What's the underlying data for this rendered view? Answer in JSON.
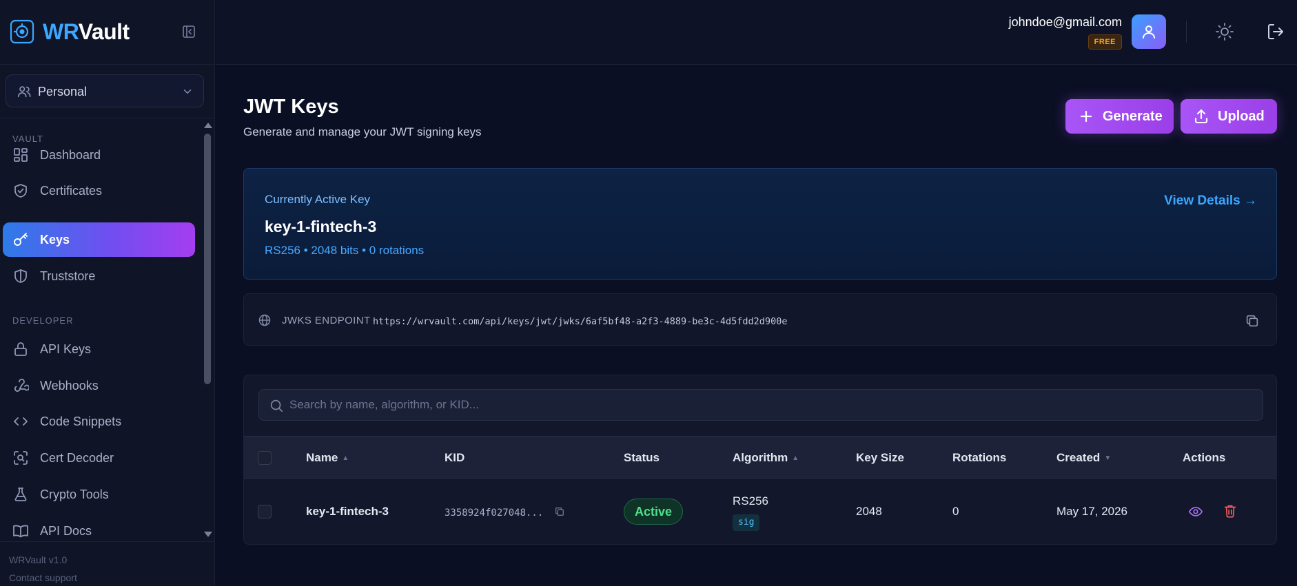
{
  "brand": {
    "prefix": "WR",
    "suffix": "Vault"
  },
  "workspace": {
    "selected": "Personal"
  },
  "sidebar": {
    "sections": [
      {
        "label": "VAULT",
        "items": [
          {
            "label": "Dashboard",
            "icon": "dashboard-icon"
          },
          {
            "label": "Certificates",
            "icon": "shield-check-icon"
          },
          {
            "label": "Keys",
            "icon": "key-icon",
            "active": true
          },
          {
            "label": "Truststore",
            "icon": "shield-icon"
          }
        ]
      },
      {
        "label": "DEVELOPER",
        "items": [
          {
            "label": "API Keys",
            "icon": "lock-icon"
          },
          {
            "label": "Webhooks",
            "icon": "webhook-icon"
          },
          {
            "label": "Code Snippets",
            "icon": "code-icon"
          },
          {
            "label": "Cert Decoder",
            "icon": "scan-icon"
          },
          {
            "label": "Crypto Tools",
            "icon": "flask-icon"
          },
          {
            "label": "API Docs",
            "icon": "book-icon"
          }
        ]
      }
    ],
    "footer": {
      "version": "WRVault v1.0",
      "support": "Contact support"
    }
  },
  "header": {
    "email": "johndoe@gmail.com",
    "plan": "FREE"
  },
  "page": {
    "title": "JWT Keys",
    "subtitle": "Generate and manage your JWT signing keys",
    "generate_label": "Generate",
    "upload_label": "Upload"
  },
  "active_key": {
    "label": "Currently Active Key",
    "name": "key-1-fintech-3",
    "meta": "RS256 • 2048 bits • 0 rotations",
    "link": "View Details →"
  },
  "jwks": {
    "label": "JWKS ENDPOINT",
    "url": "https://wrvault.com/api/keys/jwt/jwks/6af5bf48-a2f3-4889-be3c-4d5fdd2d900e"
  },
  "table": {
    "search_placeholder": "Search by name, algorithm, or KID...",
    "columns": [
      "Name",
      "KID",
      "Status",
      "Algorithm",
      "Key Size",
      "Rotations",
      "Created",
      "Actions"
    ],
    "rows": [
      {
        "name": "key-1-fintech-3",
        "kid": "3358924f027048...",
        "status": "Active",
        "algorithm": "RS256",
        "use": "sig",
        "key_size": "2048",
        "rotations": "0",
        "created": "May 17, 2026"
      }
    ]
  },
  "colors": {
    "background": "#0b0f24",
    "accent_blue": "#3ba7ff",
    "accent_purple": "#a855f7",
    "status_active": "#4ee08d",
    "plan_badge": "#f5a623",
    "danger": "#f05a5a"
  }
}
